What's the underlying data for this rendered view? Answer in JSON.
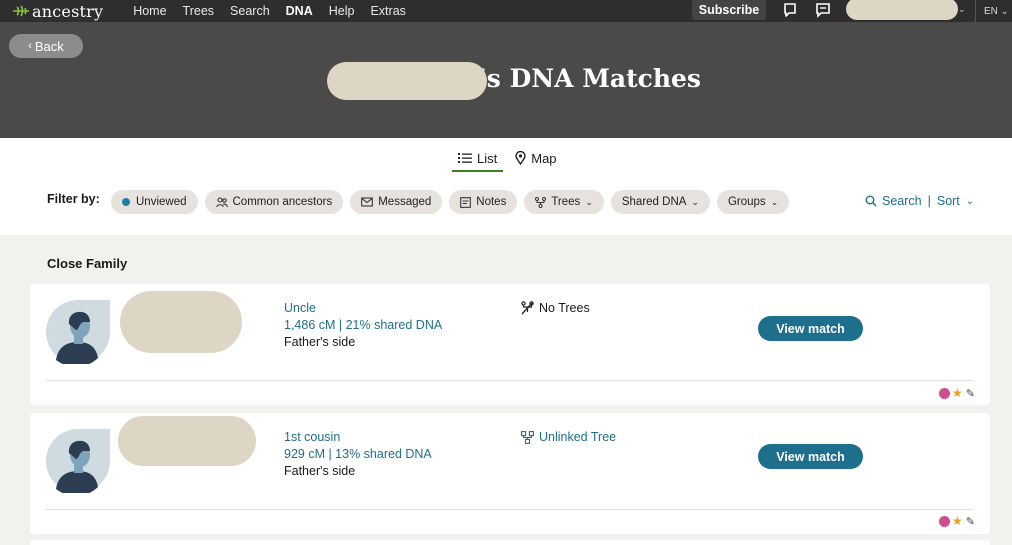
{
  "nav": {
    "brand": "ancestry",
    "links": [
      "Home",
      "Trees",
      "Search",
      "DNA",
      "Help",
      "Extras"
    ],
    "active": "DNA",
    "subscribe": "Subscribe",
    "language": "EN"
  },
  "header": {
    "back": "Back",
    "title_suffix": "n's DNA Matches"
  },
  "view_tabs": [
    "List",
    "Map"
  ],
  "filters": {
    "label": "Filter by:",
    "chips": [
      "Unviewed",
      "Common ancestors",
      "Messaged",
      "Notes",
      "Trees",
      "Shared DNA",
      "Groups"
    ],
    "search": "Search",
    "sort": "Sort"
  },
  "section": "Close Family",
  "matches": [
    {
      "relationship": "Uncle",
      "shared": "1,486 cM | 21% shared DNA",
      "side": "Father's side",
      "tree": "No Trees",
      "button": "View match"
    },
    {
      "relationship": "1st cousin",
      "shared": "929 cM | 13% shared DNA",
      "side": "Father's side",
      "tree": "Unlinked Tree",
      "button": "View match"
    }
  ],
  "colors": {
    "nav_bg": "#2e2e2e",
    "header_bg": "#4b4a48",
    "accent_blue": "#1e6f8e",
    "link_blue": "#1f6e8c",
    "active_green": "#7fb84a",
    "group_dot_pink": "#c94f8f",
    "star_gold": "#e8a317"
  },
  "icons": [
    "leaf-logo-icon",
    "list-icon",
    "map-pin-icon",
    "people-icon",
    "envelope-icon",
    "note-icon",
    "tree-icon",
    "search-icon",
    "no-tree-icon",
    "unlinked-tree-icon",
    "star-icon",
    "pencil-icon",
    "chat-icon",
    "message-icon"
  ]
}
